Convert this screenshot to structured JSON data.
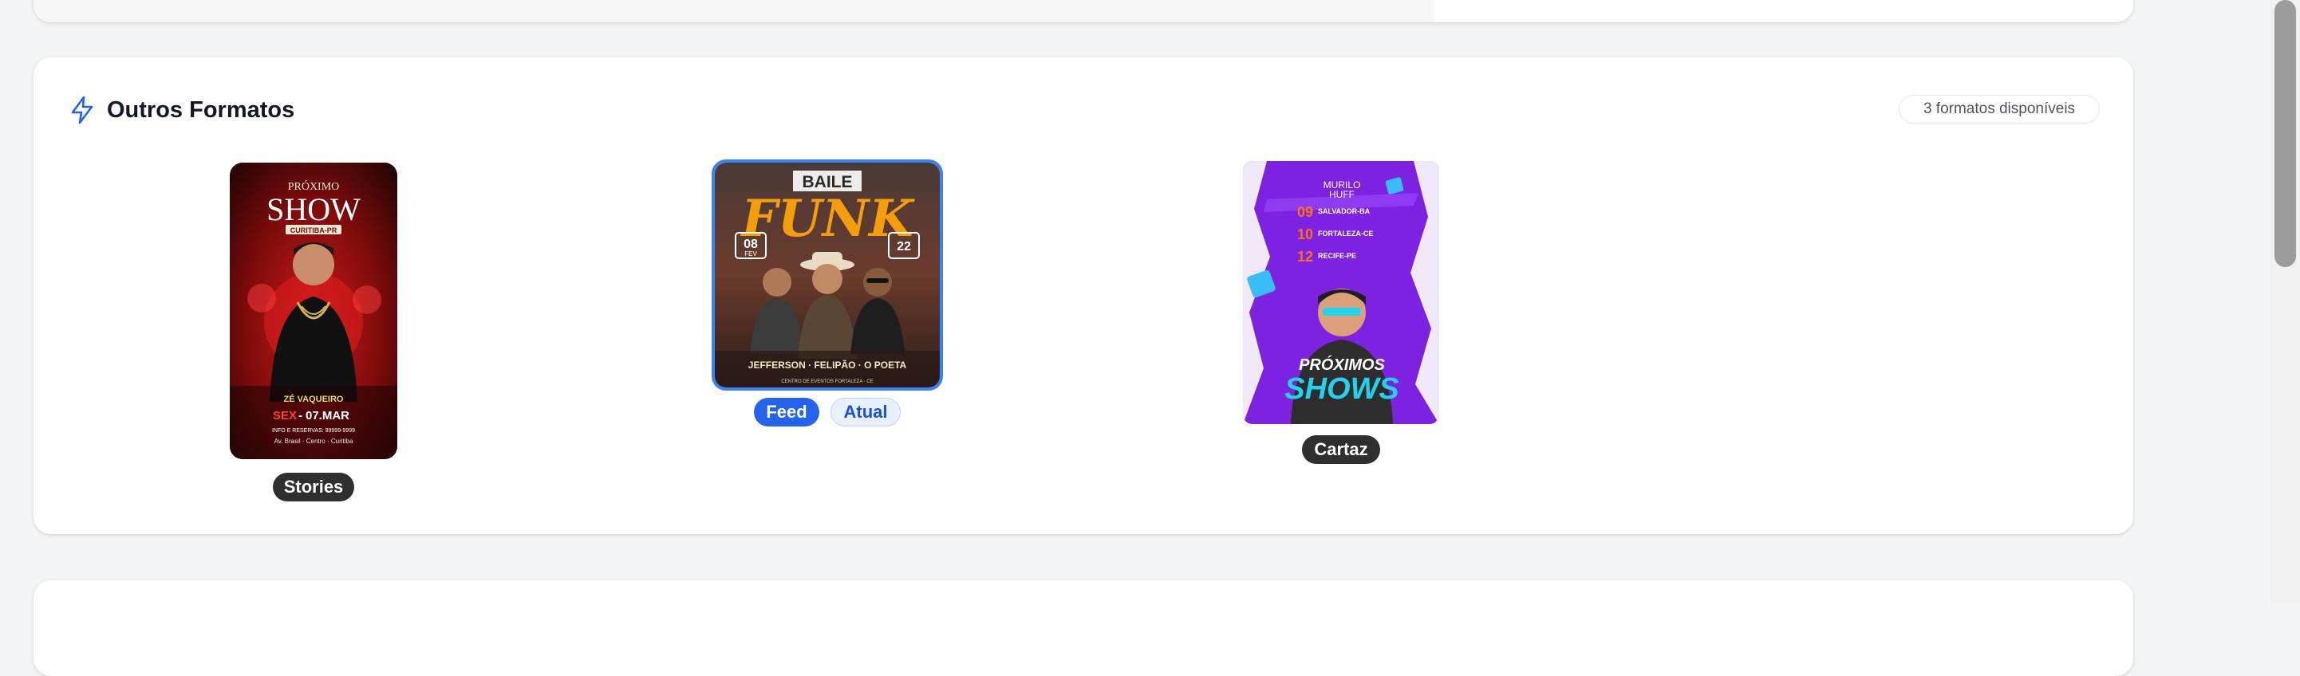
{
  "section": {
    "title": "Outros Formatos",
    "count_label": "3 formatos disponíveis",
    "icon": "lightning-icon",
    "accent": "#2563eb"
  },
  "formats": [
    {
      "label": "Stories",
      "art": {
        "line1": "PRÓXIMO",
        "line2": "SHOW",
        "city": "CURITIBA-PR",
        "artist": "ZÉ VAQUEIRO",
        "day": "SEX",
        "date": "07.MAR",
        "info": "INFO E RESERVAS: 99999-9999",
        "address": "Av. Brasil · Centro · Curitiba"
      }
    },
    {
      "label": "Feed",
      "badge": "Atual",
      "art": {
        "line1": "BAILE",
        "line2": "FUNK",
        "left_day": "08",
        "left_month": "FEV",
        "right_day": "22",
        "names": "JEFFERSON · FELIPÃO · O POETA",
        "venue": "CENTRO DE EVENTOS FORTALEZA · CE"
      }
    },
    {
      "label": "Cartaz",
      "art": {
        "brand_1": "MURILO",
        "brand_2": "HUFF",
        "dates": [
          {
            "day": "09",
            "city": "SALVADOR-BA"
          },
          {
            "day": "10",
            "city": "FORTALEZA-CE"
          },
          {
            "day": "12",
            "city": "RECIFE-PE"
          }
        ],
        "line1": "PRÓXIMOS",
        "line2": "SHOWS"
      }
    }
  ]
}
